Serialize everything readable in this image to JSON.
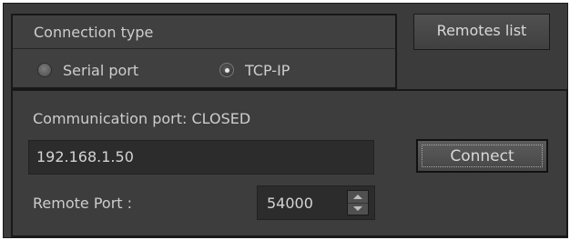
{
  "connection_type": {
    "title": "Connection type",
    "options": [
      {
        "label": "Serial port",
        "selected": false
      },
      {
        "label": "TCP-IP",
        "selected": true
      }
    ]
  },
  "remotes_list_label": "Remotes list",
  "communication": {
    "status_label": "Communication port: CLOSED",
    "ip_value": "192.168.1.50",
    "connect_label": "Connect",
    "remote_port_label": "Remote Port :",
    "remote_port_value": "54000"
  },
  "colors": {
    "background": "#3b3b3b",
    "text": "#cdcdcd",
    "field_background": "#2c2c2c"
  },
  "icons": [
    "radio-unselected-icon",
    "radio-selected-icon",
    "spin-up-arrow-icon",
    "spin-down-arrow-icon"
  ]
}
